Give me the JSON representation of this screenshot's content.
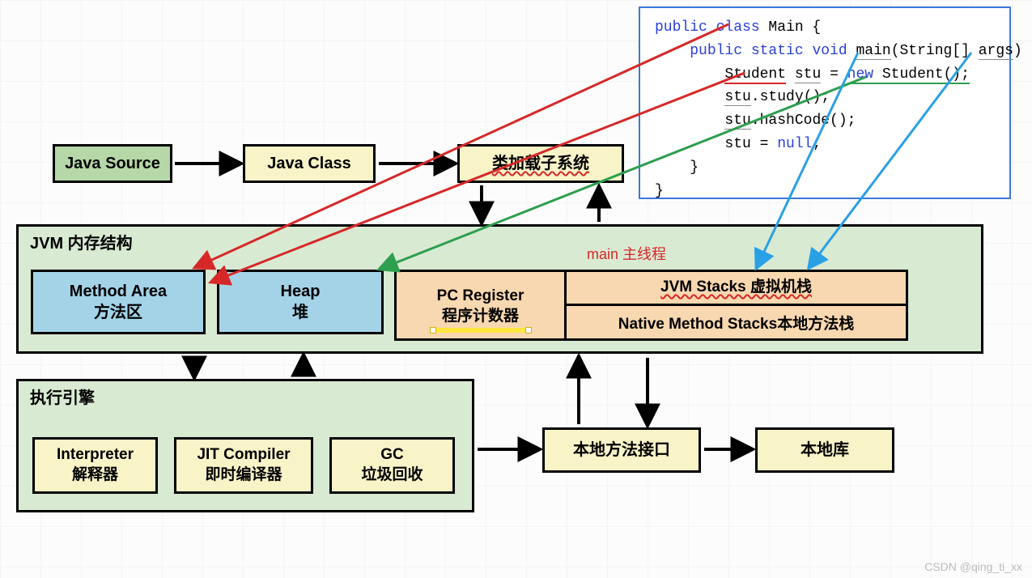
{
  "code": {
    "l1a": "public class",
    "l1b": " Main {",
    "l2a": "public static void",
    "l2b": "main",
    "l2c": "(String[] ",
    "l2d": "args",
    "l2e": ") {",
    "l3a": "Student",
    "l3b": "stu",
    "l3c": " = ",
    "l3d": "new",
    "l3e": " Student();",
    "l4a": "stu",
    "l4b": ".study();",
    "l5a": "stu",
    "l5b": ".hashCode();",
    "l6a": "st",
    "l6b": "u = ",
    "l6c": "null",
    "l6d": ";",
    "l7": "}",
    "l8": "}"
  },
  "boxes": {
    "java_source": "Java Source",
    "java_class": "Java Class",
    "classloader": "类加载子系统",
    "jvm_mem_title": "JVM 内存结构",
    "method_area_en": "Method Area",
    "method_area_cn": "方法区",
    "heap_en": "Heap",
    "heap_cn": "堆",
    "pc_en": "PC Register",
    "pc_cn": "程序计数器",
    "stacks_en": "JVM Stacks 虚拟机栈",
    "native_stacks": "Native Method Stacks本地方法栈",
    "main_thread": "main 主线程",
    "exec_engine_title": "执行引擎",
    "interp_en": "Interpreter",
    "interp_cn": "解释器",
    "jit_en": "JIT Compiler",
    "jit_cn": "即时编译器",
    "gc_en": "GC",
    "gc_cn": "垃圾回收",
    "native_if": "本地方法接口",
    "native_lib": "本地库"
  },
  "watermark": "CSDN @qing_ti_xx"
}
